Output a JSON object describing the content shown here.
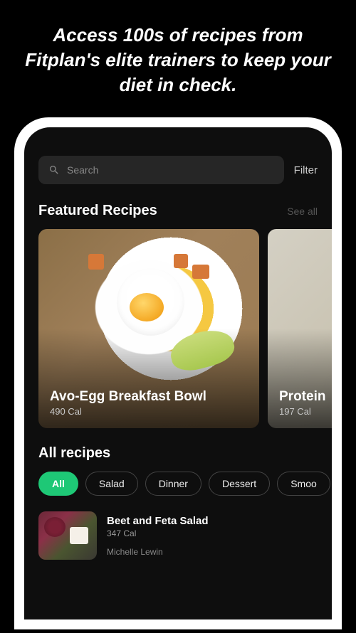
{
  "promo": "Access 100s of recipes from Fitplan's elite trainers to keep your diet in check.",
  "search": {
    "placeholder": "Search"
  },
  "filter_label": "Filter",
  "sections": {
    "featured": {
      "title": "Featured Recipes",
      "see_all": "See all"
    },
    "all": {
      "title": "All recipes"
    }
  },
  "featured_cards": [
    {
      "title": "Avo-Egg Breakfast Bowl",
      "cal": "490 Cal"
    },
    {
      "title": "Protein",
      "cal": "197 Cal"
    }
  ],
  "chips": [
    "All",
    "Salad",
    "Dinner",
    "Dessert",
    "Smoo"
  ],
  "recipes": [
    {
      "name": "Beet and Feta Salad",
      "cal": "347 Cal",
      "author": "Michelle Lewin"
    }
  ]
}
